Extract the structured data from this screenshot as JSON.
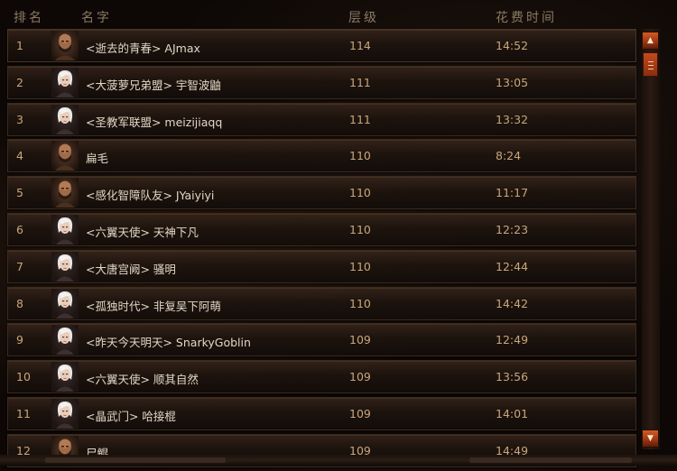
{
  "header": {
    "rank": "排名",
    "name": "名字",
    "level": "层级",
    "time": "花费时间"
  },
  "rows": [
    {
      "rank": "1",
      "name": "<逝去的青春> AJmax",
      "level": "114",
      "time": "14:52",
      "avatar": "barbarian"
    },
    {
      "rank": "2",
      "name": "<大菠萝兄弟盟> 宇智波鼬",
      "level": "111",
      "time": "13:05",
      "avatar": "monk"
    },
    {
      "rank": "3",
      "name": "<圣教军联盟> meizijiaqq",
      "level": "111",
      "time": "13:32",
      "avatar": "monk"
    },
    {
      "rank": "4",
      "name": "扁毛",
      "level": "110",
      "time": "8:24",
      "avatar": "barbarian"
    },
    {
      "rank": "5",
      "name": "<感化智障队友> JYaiyiyi",
      "level": "110",
      "time": "11:17",
      "avatar": "barbarian"
    },
    {
      "rank": "6",
      "name": "<六翼天使> 天神下凡",
      "level": "110",
      "time": "12:23",
      "avatar": "monk"
    },
    {
      "rank": "7",
      "name": "<大唐宫阙> 骚明",
      "level": "110",
      "time": "12:44",
      "avatar": "monk"
    },
    {
      "rank": "8",
      "name": "<孤独时代> 非复吴下阿萌",
      "level": "110",
      "time": "14:42",
      "avatar": "monk"
    },
    {
      "rank": "9",
      "name": "<昨天今天明天> SnarkyGoblin",
      "level": "109",
      "time": "12:49",
      "avatar": "monk"
    },
    {
      "rank": "10",
      "name": "<六翼天使> 顺其自然",
      "level": "109",
      "time": "13:56",
      "avatar": "monk"
    },
    {
      "rank": "11",
      "name": "<晶武门> 哈接棍",
      "level": "109",
      "time": "14:01",
      "avatar": "monk"
    },
    {
      "rank": "12",
      "name": "尸鲲",
      "level": "109",
      "time": "14:49",
      "avatar": "barbarian"
    }
  ],
  "scrollbar": {
    "up_icon": "arrow-up-icon",
    "down_icon": "arrow-down-icon",
    "thumb_icon": "grip-icon"
  },
  "colors": {
    "accent": "#c24a1b",
    "text": "#c9a67a",
    "name_text": "#e2d6c4",
    "header_text": "#8a7a63"
  }
}
